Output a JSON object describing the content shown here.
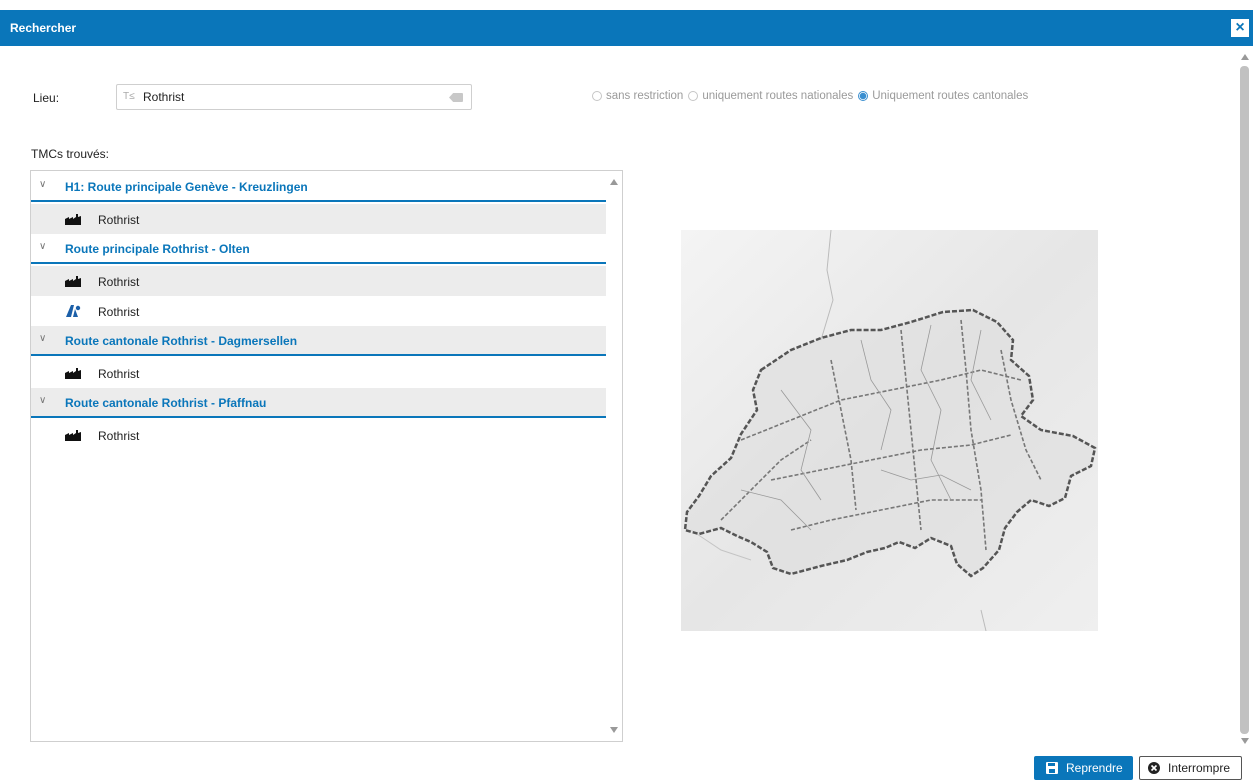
{
  "dialog": {
    "title": "Rechercher",
    "close_label": "×"
  },
  "search": {
    "label": "Lieu:",
    "type_icon_text": "T̂T",
    "value": "Rothrist",
    "restriction_options": [
      {
        "label": "sans restriction",
        "checked": false
      },
      {
        "label": "uniquement routes nationales",
        "checked": false
      },
      {
        "label": "Uniquement routes cantonales",
        "checked": true
      }
    ]
  },
  "results": {
    "label": "TMCs trouvés:",
    "groups": [
      {
        "title": "H1: Route principale Genève - Kreuzlingen",
        "items": [
          {
            "label": "Rothrist",
            "icon": "factory-icon"
          }
        ]
      },
      {
        "title": "Route principale Rothrist - Olten",
        "items": [
          {
            "label": "Rothrist",
            "icon": "factory-icon"
          },
          {
            "label": "Rothrist",
            "icon": "road-junction-icon"
          }
        ]
      },
      {
        "title": "Route cantonale Rothrist - Dagmersellen",
        "items": [
          {
            "label": "Rothrist",
            "icon": "factory-icon"
          }
        ]
      },
      {
        "title": "Route cantonale Rothrist - Pfaffnau",
        "items": [
          {
            "label": "Rothrist",
            "icon": "factory-icon"
          }
        ]
      }
    ]
  },
  "buttons": {
    "accept_label": "Reprendre",
    "cancel_label": "Interrompre"
  },
  "colors": {
    "accent": "#0a76ba",
    "row_grey": "#ececec",
    "text": "#222222"
  }
}
